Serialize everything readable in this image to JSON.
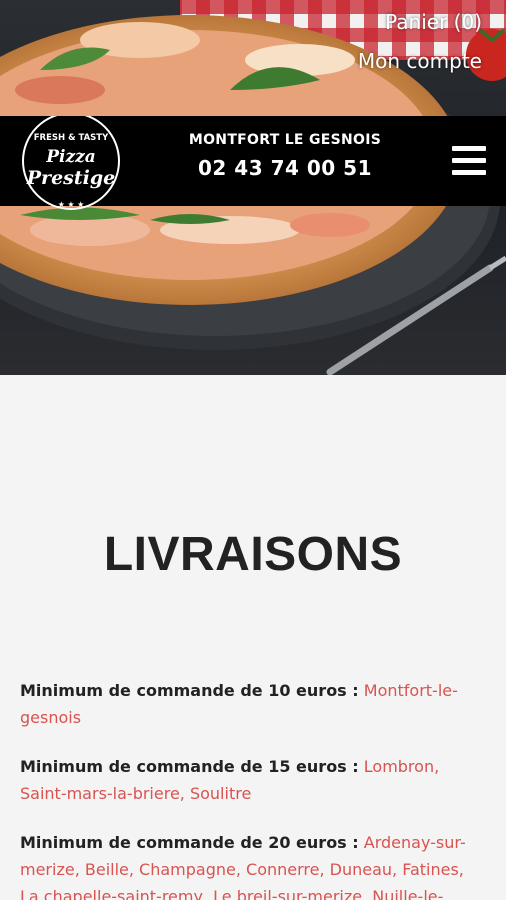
{
  "top_links": {
    "cart": "Panier (0)",
    "account": "Mon compte"
  },
  "header": {
    "logo_line1": "FRESH & TASTY",
    "logo_line2": "Pizza",
    "logo_line3": "Prestige",
    "city": "MONTFORT LE GESNOIS",
    "phone": "02 43 74 00 51",
    "menu_icon": "hamburger-menu-icon"
  },
  "page": {
    "title": "LIVRAISONS"
  },
  "deliveries": [
    {
      "label": "Minimum de commande de 10 euros :",
      "towns": "Montfort-le-gesnois"
    },
    {
      "label": "Minimum de commande de 15 euros :",
      "towns": "Lombron, Saint-mars-la-briere, Soulitre"
    },
    {
      "label": "Minimum de commande de 20 euros :",
      "towns": "Ardenay-sur-merize, Beille, Champagne, Connerre, Duneau, Fatines, La chapelle-saint-remy, Le breil-sur-merize, Nuille-le-"
    }
  ],
  "colors": {
    "accent": "#d9534f",
    "header_bg": "#000000",
    "text": "#222222"
  }
}
